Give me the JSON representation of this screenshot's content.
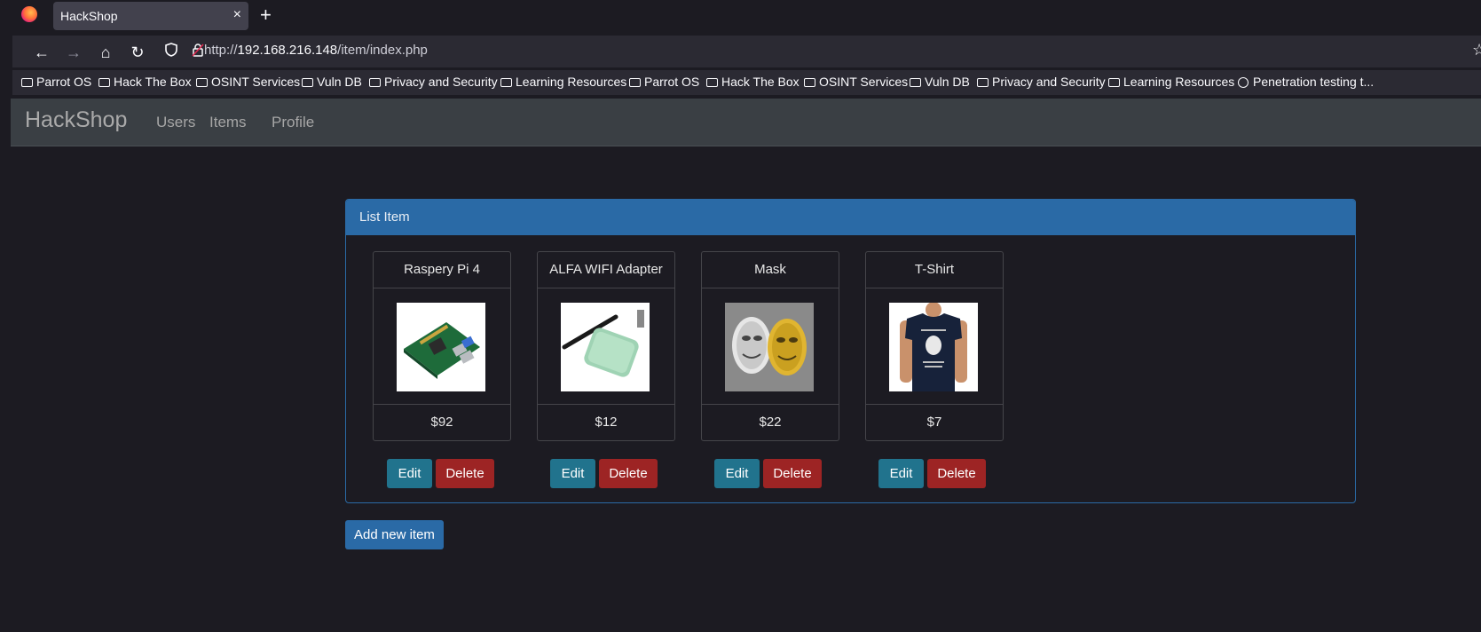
{
  "browser": {
    "tab_title": "HackShop",
    "tab_close": "×",
    "new_tab": "+",
    "url_prefix": "http://",
    "url_host": "192.168.216.148",
    "url_path": "/item/index.php"
  },
  "bookmarks": [
    "Parrot OS",
    "Hack The Box",
    "OSINT Services",
    "Vuln DB",
    "Privacy and Security",
    "Learning Resources",
    "Parrot OS",
    "Hack The Box",
    "OSINT Services",
    "Vuln DB",
    "Privacy and Security",
    "Learning Resources",
    "Penetration testing t..."
  ],
  "site": {
    "brand": "HackShop",
    "nav": {
      "users": "Users",
      "items": "Items",
      "profile": "Profile"
    }
  },
  "panel": {
    "heading": "List Item",
    "items": [
      {
        "name": "Raspery Pi 4",
        "price": "$92",
        "edit": "Edit",
        "delete": "Delete",
        "image": "raspberry-pi-board"
      },
      {
        "name": "ALFA WIFI Adapter",
        "price": "$12",
        "edit": "Edit",
        "delete": "Delete",
        "image": "wifi-adapter"
      },
      {
        "name": "Mask",
        "price": "$22",
        "edit": "Edit",
        "delete": "Delete",
        "image": "guy-fawkes-masks"
      },
      {
        "name": "T-Shirt",
        "price": "$7",
        "edit": "Edit",
        "delete": "Delete",
        "image": "navy-t-shirt"
      }
    ]
  },
  "add_button": "Add new item",
  "colors": {
    "primary": "#2a6aa6",
    "edit": "#21738d",
    "delete": "#9d2424",
    "background": "#1c1b22"
  }
}
